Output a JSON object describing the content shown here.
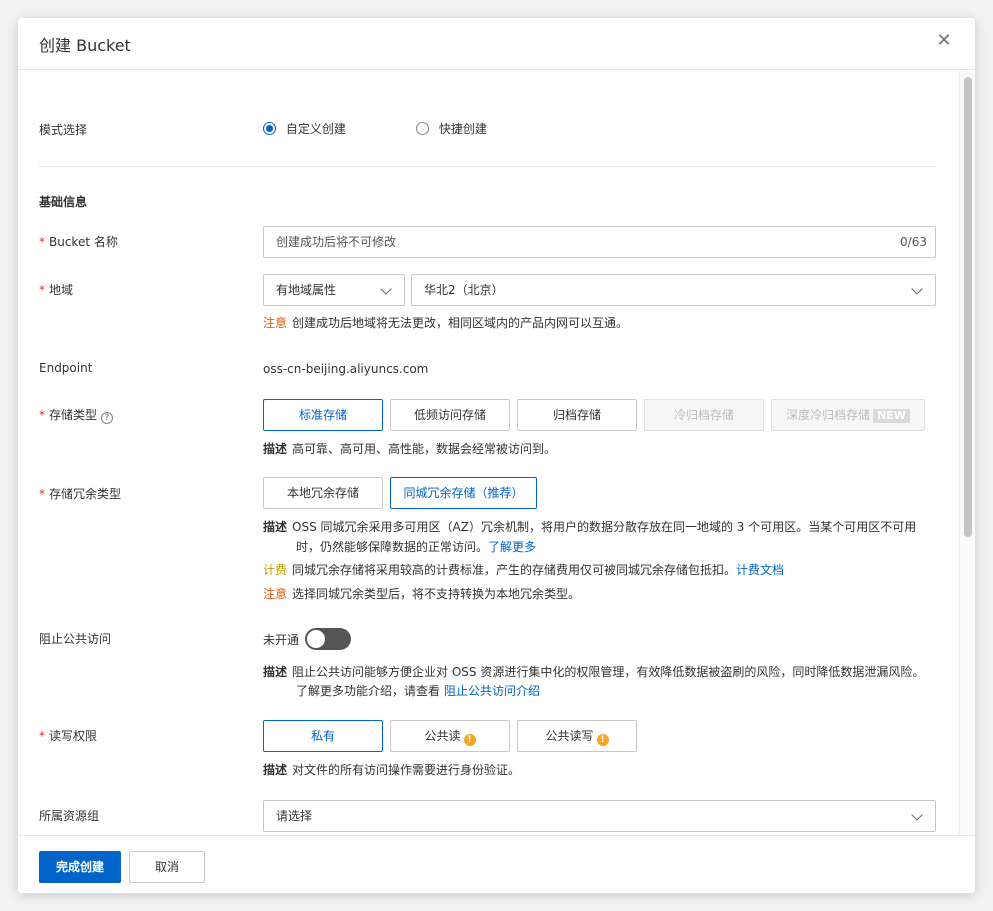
{
  "dialog": {
    "title": "创建 Bucket",
    "close_icon": "close-icon"
  },
  "mode": {
    "label": "模式选择",
    "options": [
      {
        "label": "自定义创建",
        "selected": true
      },
      {
        "label": "快捷创建",
        "selected": false
      }
    ]
  },
  "section_basic": "基础信息",
  "bucket_name": {
    "required_mark": "*",
    "label": "Bucket 名称",
    "placeholder": "创建成功后将不可修改",
    "counter": "0/63"
  },
  "region": {
    "required_mark": "*",
    "label": "地域",
    "attr_select": "有地域属性",
    "region_select": "华北2（北京）",
    "note_key": "注意",
    "note_text": "创建成功后地域将无法更改，相同区域内的产品内网可以互通。"
  },
  "endpoint": {
    "label": "Endpoint",
    "value": "oss-cn-beijing.aliyuncs.com"
  },
  "storage_class": {
    "required_mark": "*",
    "label": "存储类型",
    "help_icon": "question-circle-icon",
    "help_glyph": "?",
    "options": [
      {
        "label": "标准存储",
        "state": "selected"
      },
      {
        "label": "低频访问存储",
        "state": "normal"
      },
      {
        "label": "归档存储",
        "state": "normal"
      },
      {
        "label": "冷归档存储",
        "state": "disabled"
      },
      {
        "label": "深度冷归档存储",
        "state": "disabled",
        "tag": "NEW"
      }
    ],
    "desc_key": "描述",
    "desc_text": "高可靠、高可用、高性能，数据会经常被访问到。"
  },
  "redundancy": {
    "required_mark": "*",
    "label": "存储冗余类型",
    "options": [
      {
        "label": "本地冗余存储",
        "state": "normal"
      },
      {
        "label": "同城冗余存储（推荐）",
        "state": "selected"
      }
    ],
    "desc_key": "描述",
    "desc_line1": "OSS 同城冗余采用多可用区（AZ）冗余机制，将用户的数据分散存放在同一地域的 3 个可用区。当某个可用区不可用",
    "desc_line2": "时，仍然能够保障数据的正常访问。",
    "desc_link": "了解更多",
    "fee_key": "计费",
    "fee_text": "同城冗余存储将采用较高的计费标准，产生的存储费用仅可被同城冗余存储包抵扣。",
    "fee_link": "计费文档",
    "note_key": "注意",
    "note_text": "选择同城冗余类型后，将不支持转换为本地冗余类型。"
  },
  "block_public": {
    "label": "阻止公共访问",
    "toggle_label": "未开通",
    "toggle_on": false,
    "desc_key": "描述",
    "desc_line1": "阻止公共访问能够方便企业对 OSS 资源进行集中化的权限管理，有效降低数据被盗刷的风险，同时降低数据泄漏风险。",
    "desc_line2": "了解更多功能介绍，请查看",
    "desc_link": "阻止公共访问介绍"
  },
  "acl": {
    "required_mark": "*",
    "label": "读写权限",
    "options": [
      {
        "label": "私有",
        "state": "selected"
      },
      {
        "label": "公共读",
        "state": "normal",
        "warn": "!"
      },
      {
        "label": "公共读写",
        "state": "normal",
        "warn": "!"
      }
    ],
    "desc_key": "描述",
    "desc_text": "对文件的所有访问操作需要进行身份验证。"
  },
  "resource_group": {
    "label": "所属资源组",
    "placeholder": "请选择"
  },
  "footer": {
    "confirm": "完成创建",
    "cancel": "取消"
  },
  "colors": {
    "primary": "#0064c8",
    "required": "#d93026",
    "note": "#e8590c",
    "fee": "#c89a00",
    "warn": "#f5a623"
  }
}
